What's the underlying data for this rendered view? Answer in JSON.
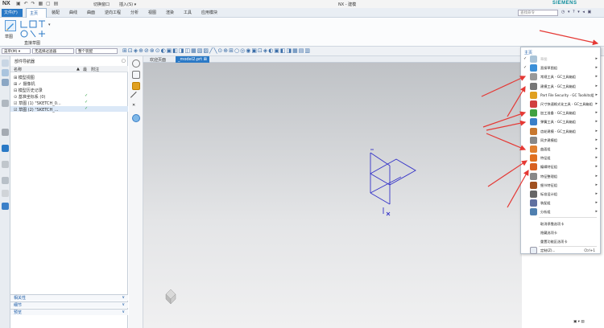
{
  "titlebar": {
    "logo": "NX",
    "quick_access": "▣ ↶ ↷ ▦ ▢ ▤",
    "switch_window": "切换窗口",
    "insert": "插入(S) ▾",
    "app_title": "NX - 建模",
    "brand": "SIEMENS"
  },
  "menubar": {
    "file": "文件(F)",
    "tabs": [
      "主页",
      "装配",
      "曲线",
      "曲面",
      "逆向工程",
      "分析",
      "视图",
      "渲染",
      "工具",
      "应用模块"
    ],
    "search_placeholder": "查找命令",
    "right_icons": "◷ ▾ ? ▾ ◂ ▣"
  },
  "ribbon": {
    "sketch_label": "草图",
    "group_label": "直接草图"
  },
  "selbar": {
    "menu": "菜单(M) ▾",
    "filter": "无选择过滤器",
    "scope": "整个装配"
  },
  "navigator": {
    "title": "部件导航器",
    "columns": [
      "名称",
      "▲",
      "最",
      "附注"
    ],
    "rows": [
      {
        "label": "⊞ 模型视图",
        "check": false,
        "sel": false
      },
      {
        "label": "⊞ ✓ 摄像机",
        "check": false,
        "sel": false
      },
      {
        "label": "⊟ 模型历史记录",
        "check": false,
        "sel": false
      },
      {
        "label": "   ⊙ 基准坐标系 (0)",
        "check": true,
        "sel": false
      },
      {
        "label": "   ☑ 草图 (1) \"SKETCH_0...",
        "check": true,
        "sel": false
      },
      {
        "label": "   ☑ 草图 (2) \"SKETCH_...",
        "check": true,
        "sel": true
      }
    ],
    "accordions": [
      "相关性",
      "细节",
      "预览"
    ]
  },
  "graphics_tabs": {
    "welcome": "欢迎页面",
    "model": "_model2.prt ⊠"
  },
  "menu": {
    "header": "主页",
    "items": [
      {
        "label": "草图",
        "checked": true,
        "dim": true,
        "color": "#aac4d8"
      },
      {
        "label": "直接草图组",
        "checked": true,
        "dim": false,
        "color": "#3a8fd8"
      },
      {
        "label": "常规工具 - GC工具箱组",
        "checked": false,
        "dim": false,
        "color": "#999999"
      },
      {
        "label": "建模工具 - GC工具箱组",
        "checked": false,
        "dim": false,
        "color": "#777777"
      },
      {
        "label": "Part File Security - GC Toolkits组",
        "checked": false,
        "dim": false,
        "color": "#e0a020"
      },
      {
        "label": "尺寸快速格式化工具 - GC工具箱组",
        "checked": false,
        "dim": false,
        "color": "#d04040"
      },
      {
        "label": "加工准备 - GC工具箱组",
        "checked": false,
        "dim": false,
        "color": "#40a040"
      },
      {
        "label": "弹簧工具 - GC工具箱组",
        "checked": false,
        "dim": false,
        "color": "#3a7fc8"
      },
      {
        "label": "齿轮建模 - GC工具箱组",
        "checked": false,
        "dim": false,
        "color": "#c87830"
      },
      {
        "label": "同步建模组",
        "checked": false,
        "dim": false,
        "color": "#888888"
      },
      {
        "label": "曲面组",
        "checked": false,
        "dim": false,
        "color": "#e08030"
      },
      {
        "label": "特征组",
        "checked": false,
        "dim": false,
        "color": "#e07020"
      },
      {
        "label": "编辑特征组",
        "checked": false,
        "dim": false,
        "color": "#d86020"
      },
      {
        "label": "特征整理组",
        "checked": false,
        "dim": false,
        "color": "#888888"
      },
      {
        "label": "细节特征组",
        "checked": false,
        "dim": false,
        "color": "#a05020"
      },
      {
        "label": "标准设计组",
        "checked": false,
        "dim": false,
        "color": "#666666"
      },
      {
        "label": "装配组",
        "checked": false,
        "dim": false,
        "color": "#6070a0"
      },
      {
        "label": "分析组",
        "checked": false,
        "dim": false,
        "color": "#5080b0"
      }
    ],
    "plain": [
      "取消停靠选项卡",
      "隐藏选项卡",
      "重置功能区选项卡"
    ],
    "customize": "定制(Z)...",
    "customize_shortcut": "Ctrl+1"
  },
  "bottom_right": "▣ ▾ ▤"
}
